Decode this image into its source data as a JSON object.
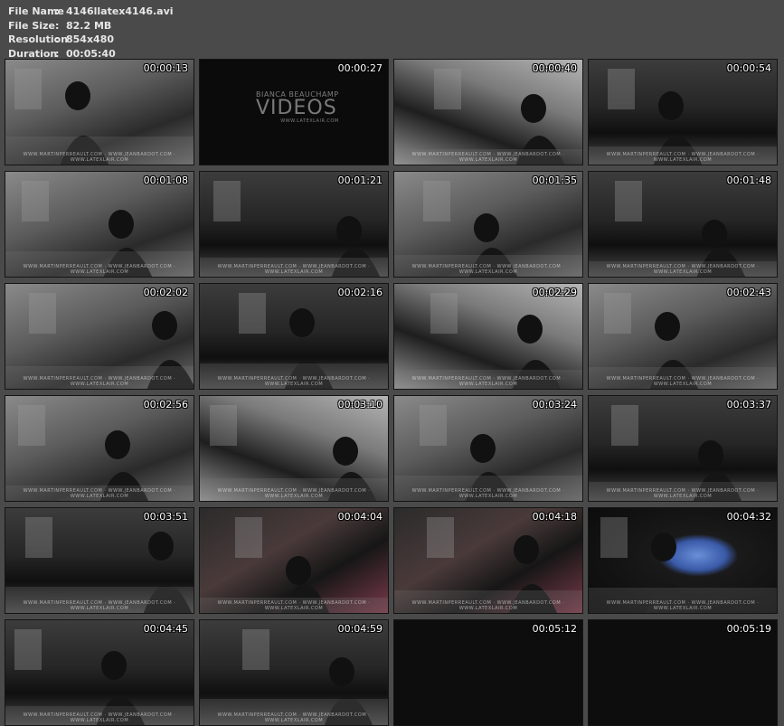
{
  "info": {
    "file_name_label": "File Name",
    "file_name": "4146llatex4146.avi",
    "file_size_label": "File Size",
    "file_size": "82.2 MB",
    "resolution_label": "Resolution",
    "resolution": "854x480",
    "duration_label": "Duration",
    "duration": "00:05:40",
    "separator": ":"
  },
  "intro_logo": {
    "line1": "BIANCA BEAUCHAMP",
    "line2": "VIDEOS",
    "line3": "WWW.LATEXLAIR.COM"
  },
  "watermark": "WWW.MARTINPERREAULT.COM · WWW.JEANBARDOT.COM · WWW.LATEXLAIR.COM",
  "thumbnails": [
    {
      "time": "00:00:13",
      "scene": "studio-grey"
    },
    {
      "time": "00:00:27",
      "scene": "black-logo"
    },
    {
      "time": "00:00:40",
      "scene": "studio-light"
    },
    {
      "time": "00:00:54",
      "scene": "studio-dark"
    },
    {
      "time": "00:01:08",
      "scene": "studio-grey"
    },
    {
      "time": "00:01:21",
      "scene": "studio-dark"
    },
    {
      "time": "00:01:35",
      "scene": "studio-grey"
    },
    {
      "time": "00:01:48",
      "scene": "studio-dark"
    },
    {
      "time": "00:02:02",
      "scene": "studio-grey"
    },
    {
      "time": "00:02:16",
      "scene": "studio-dark"
    },
    {
      "time": "00:02:29",
      "scene": "studio-light"
    },
    {
      "time": "00:02:43",
      "scene": "studio-grey"
    },
    {
      "time": "00:02:56",
      "scene": "studio-grey"
    },
    {
      "time": "00:03:10",
      "scene": "studio-light"
    },
    {
      "time": "00:03:24",
      "scene": "studio-grey"
    },
    {
      "time": "00:03:37",
      "scene": "studio-dark"
    },
    {
      "time": "00:03:51",
      "scene": "studio-dark"
    },
    {
      "time": "00:04:04",
      "scene": "studio-color"
    },
    {
      "time": "00:04:18",
      "scene": "studio-color"
    },
    {
      "time": "00:04:32",
      "scene": "camera-screen"
    },
    {
      "time": "00:04:45",
      "scene": "studio-dark"
    },
    {
      "time": "00:04:59",
      "scene": "studio-dark"
    },
    {
      "time": "00:05:12",
      "scene": "black"
    },
    {
      "time": "00:05:19",
      "scene": "black"
    }
  ]
}
